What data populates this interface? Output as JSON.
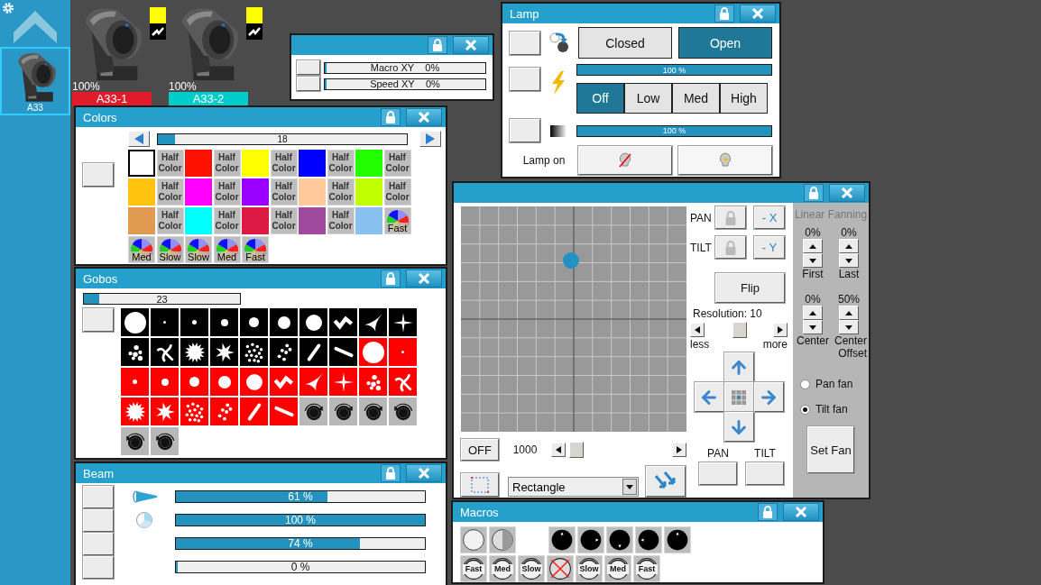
{
  "sidebar": {
    "items": [
      {
        "label": "A33",
        "selected": true
      }
    ]
  },
  "fixtures": [
    {
      "reading": "100%",
      "label": "A33-1",
      "color": "#e21b2a"
    },
    {
      "reading": "100%",
      "label": "A33-2",
      "color": "#00cccc"
    }
  ],
  "xy_window": {
    "rows": [
      {
        "label": "Macro XY",
        "reading": "0%",
        "level": 0
      },
      {
        "label": "Speed XY",
        "reading": "0%",
        "level": 0
      }
    ]
  },
  "lamp": {
    "title": "Lamp",
    "shutter": [
      {
        "label": "Closed",
        "selected": false
      },
      {
        "label": "Open",
        "selected": true
      }
    ],
    "power": {
      "reading": "100 %",
      "level": 1
    },
    "modes": [
      {
        "label": "Off",
        "selected": true
      },
      {
        "label": "Low",
        "selected": false
      },
      {
        "label": "Med",
        "selected": false
      },
      {
        "label": "High",
        "selected": false
      }
    ],
    "dimmer": {
      "reading": "100 %",
      "level": 1
    },
    "lamp_label": "Lamp on"
  },
  "colors": {
    "title": "Colors",
    "slider": {
      "reading": "18",
      "level": 0.07
    },
    "swatches": [
      {
        "kind": "color",
        "color": "#ffffff",
        "selected": true
      },
      {
        "kind": "half",
        "label": "Half Color",
        "selected": false
      },
      {
        "kind": "color",
        "color": "#ff1100",
        "selected": false
      },
      {
        "kind": "half",
        "label": "Half Color",
        "selected": false
      },
      {
        "kind": "color",
        "color": "#ffff00",
        "selected": false
      },
      {
        "kind": "half",
        "label": "Half Color",
        "selected": false
      },
      {
        "kind": "color",
        "color": "#0000ff",
        "selected": false
      },
      {
        "kind": "half",
        "label": "Half Color",
        "selected": false
      },
      {
        "kind": "color",
        "color": "#22ff00",
        "selected": false
      },
      {
        "kind": "half",
        "label": "Half Color",
        "selected": false
      },
      {
        "kind": "color",
        "color": "#ffc30f",
        "selected": false
      },
      {
        "kind": "half",
        "label": "Half Color",
        "selected": false
      },
      {
        "kind": "color",
        "color": "#ff00ff",
        "selected": false
      },
      {
        "kind": "half",
        "label": "Half Color",
        "selected": false
      },
      {
        "kind": "color",
        "color": "#9900ff",
        "selected": false
      },
      {
        "kind": "half",
        "label": "Half Color",
        "selected": false
      },
      {
        "kind": "color",
        "color": "#ffc99c",
        "selected": false
      },
      {
        "kind": "half",
        "label": "Half Color",
        "selected": false
      },
      {
        "kind": "color",
        "color": "#c0ff00",
        "selected": false
      },
      {
        "kind": "half",
        "label": "Half Color",
        "selected": false
      },
      {
        "kind": "color",
        "color": "#e09a52",
        "selected": false
      },
      {
        "kind": "half",
        "label": "Half Color",
        "selected": false
      },
      {
        "kind": "color",
        "color": "#00ffff",
        "selected": false
      },
      {
        "kind": "half",
        "label": "Half Color",
        "selected": false
      },
      {
        "kind": "color",
        "color": "#dc1a44",
        "selected": false
      },
      {
        "kind": "half",
        "label": "Half Color",
        "selected": false
      },
      {
        "kind": "color",
        "color": "#a04a9e",
        "selected": false
      },
      {
        "kind": "half",
        "label": "Half Color",
        "selected": false
      },
      {
        "kind": "color",
        "color": "#88c0f0",
        "selected": false
      },
      {
        "kind": "wheel",
        "label": "Fast",
        "selected": false
      },
      {
        "kind": "wheel",
        "label": "Med",
        "selected": false
      },
      {
        "kind": "wheel",
        "label": "Slow",
        "selected": false
      },
      {
        "kind": "wheel",
        "label": "Slow",
        "selected": false
      },
      {
        "kind": "wheel",
        "label": "Med",
        "selected": false
      },
      {
        "kind": "wheel",
        "label": "Fast",
        "selected": false
      }
    ]
  },
  "gobos": {
    "title": "Gobos",
    "slider": {
      "reading": "23",
      "level": 0.1
    },
    "items": [
      {
        "kind": "disc-full",
        "color": "#000000"
      },
      {
        "kind": "disc-xs",
        "color": "#000000"
      },
      {
        "kind": "disc-s",
        "color": "#000000"
      },
      {
        "kind": "disc-m",
        "color": "#000000"
      },
      {
        "kind": "disc-l",
        "color": "#000000"
      },
      {
        "kind": "disc-xl",
        "color": "#000000"
      },
      {
        "kind": "disc-xxl",
        "color": "#000000"
      },
      {
        "kind": "bars",
        "color": "#000000"
      },
      {
        "kind": "tri",
        "color": "#000000"
      },
      {
        "kind": "star",
        "color": "#000000"
      },
      {
        "kind": "dots",
        "color": "#000000"
      },
      {
        "kind": "swirl",
        "color": "#000000"
      },
      {
        "kind": "burst",
        "color": "#000000"
      },
      {
        "kind": "splat",
        "color": "#000000"
      },
      {
        "kind": "scatter",
        "color": "#000000"
      },
      {
        "kind": "fewdots",
        "color": "#000000"
      },
      {
        "kind": "line",
        "color": "#000000"
      },
      {
        "kind": "line2",
        "color": "#000000"
      },
      {
        "kind": "disc-full",
        "color": "#ff0000"
      },
      {
        "kind": "disc-xs",
        "color": "#ff0000"
      },
      {
        "kind": "disc-s",
        "color": "#ff0000"
      },
      {
        "kind": "disc-m",
        "color": "#ff0000"
      },
      {
        "kind": "disc-l",
        "color": "#ff0000"
      },
      {
        "kind": "disc-xl",
        "color": "#ff0000"
      },
      {
        "kind": "disc-xxl",
        "color": "#ff0000"
      },
      {
        "kind": "bars",
        "color": "#ff0000"
      },
      {
        "kind": "tri",
        "color": "#ff0000"
      },
      {
        "kind": "star",
        "color": "#ff0000"
      },
      {
        "kind": "dots",
        "color": "#ff0000"
      },
      {
        "kind": "swirl",
        "color": "#ff0000"
      },
      {
        "kind": "burst",
        "color": "#ff0000"
      },
      {
        "kind": "splat",
        "color": "#ff0000"
      },
      {
        "kind": "scatter",
        "color": "#ff0000"
      },
      {
        "kind": "fewdots",
        "color": "#ff0000"
      },
      {
        "kind": "line",
        "color": "#ff0000"
      },
      {
        "kind": "line2",
        "color": "#ff0000"
      },
      {
        "kind": "spin-cw",
        "color": "#b8b8b8"
      },
      {
        "kind": "spin-cw",
        "color": "#b8b8b8"
      },
      {
        "kind": "spin-cw",
        "color": "#b8b8b8"
      },
      {
        "kind": "spin-ccw",
        "color": "#b8b8b8"
      },
      {
        "kind": "spin-ccw",
        "color": "#b8b8b8"
      },
      {
        "kind": "spin-ccw",
        "color": "#b8b8b8"
      }
    ]
  },
  "beam": {
    "title": "Beam",
    "rows": [
      {
        "kind": "zoom",
        "reading": "61 %",
        "level": 0.61
      },
      {
        "kind": "iris",
        "reading": "100 %",
        "level": 1
      },
      {
        "kind": "plain",
        "reading": "74 %",
        "level": 0.74
      },
      {
        "kind": "plain",
        "reading": "0 %",
        "level": 0
      }
    ]
  },
  "position": {
    "axes": [
      {
        "label": "PAN",
        "invert": "- X"
      },
      {
        "label": "TILT",
        "invert": "- Y"
      }
    ],
    "flip": "Flip",
    "resolution": {
      "label": "Resolution: 10",
      "min_label": "less",
      "max_label": "more"
    },
    "off": "OFF",
    "speed": {
      "reading": "1000",
      "level": 0
    },
    "shape": "Rectangle",
    "outputs": [
      {
        "label": "PAN"
      },
      {
        "label": "TILT"
      }
    ],
    "fanning": {
      "title": "Linear Fanning",
      "spinners": [
        {
          "reading": "0%",
          "label": "First"
        },
        {
          "reading": "0%",
          "label": "Last"
        },
        {
          "reading": "0%",
          "label": "Center"
        },
        {
          "reading": "50%",
          "label": "Center Offset"
        }
      ],
      "modes": [
        {
          "label": "Pan fan",
          "selected": false
        },
        {
          "label": "Tilt fan",
          "selected": true
        }
      ],
      "button": "Set Fan"
    }
  },
  "macros": {
    "title": "Macros",
    "rows": [
      [
        {
          "kind": "open"
        },
        {
          "kind": "half"
        },
        {
          "kind": "dial-n"
        },
        {
          "kind": "dial-e"
        },
        {
          "kind": "dial-s"
        },
        {
          "kind": "dial-w"
        },
        {
          "kind": "dial-n"
        }
      ],
      [
        {
          "kind": "speed",
          "label": "Fast"
        },
        {
          "kind": "speed",
          "label": "Med"
        },
        {
          "kind": "speed",
          "label": "Slow"
        },
        {
          "kind": "stop"
        },
        {
          "kind": "speed",
          "label": "Slow"
        },
        {
          "kind": "speed",
          "label": "Med"
        },
        {
          "kind": "speed",
          "label": "Fast"
        }
      ]
    ]
  }
}
